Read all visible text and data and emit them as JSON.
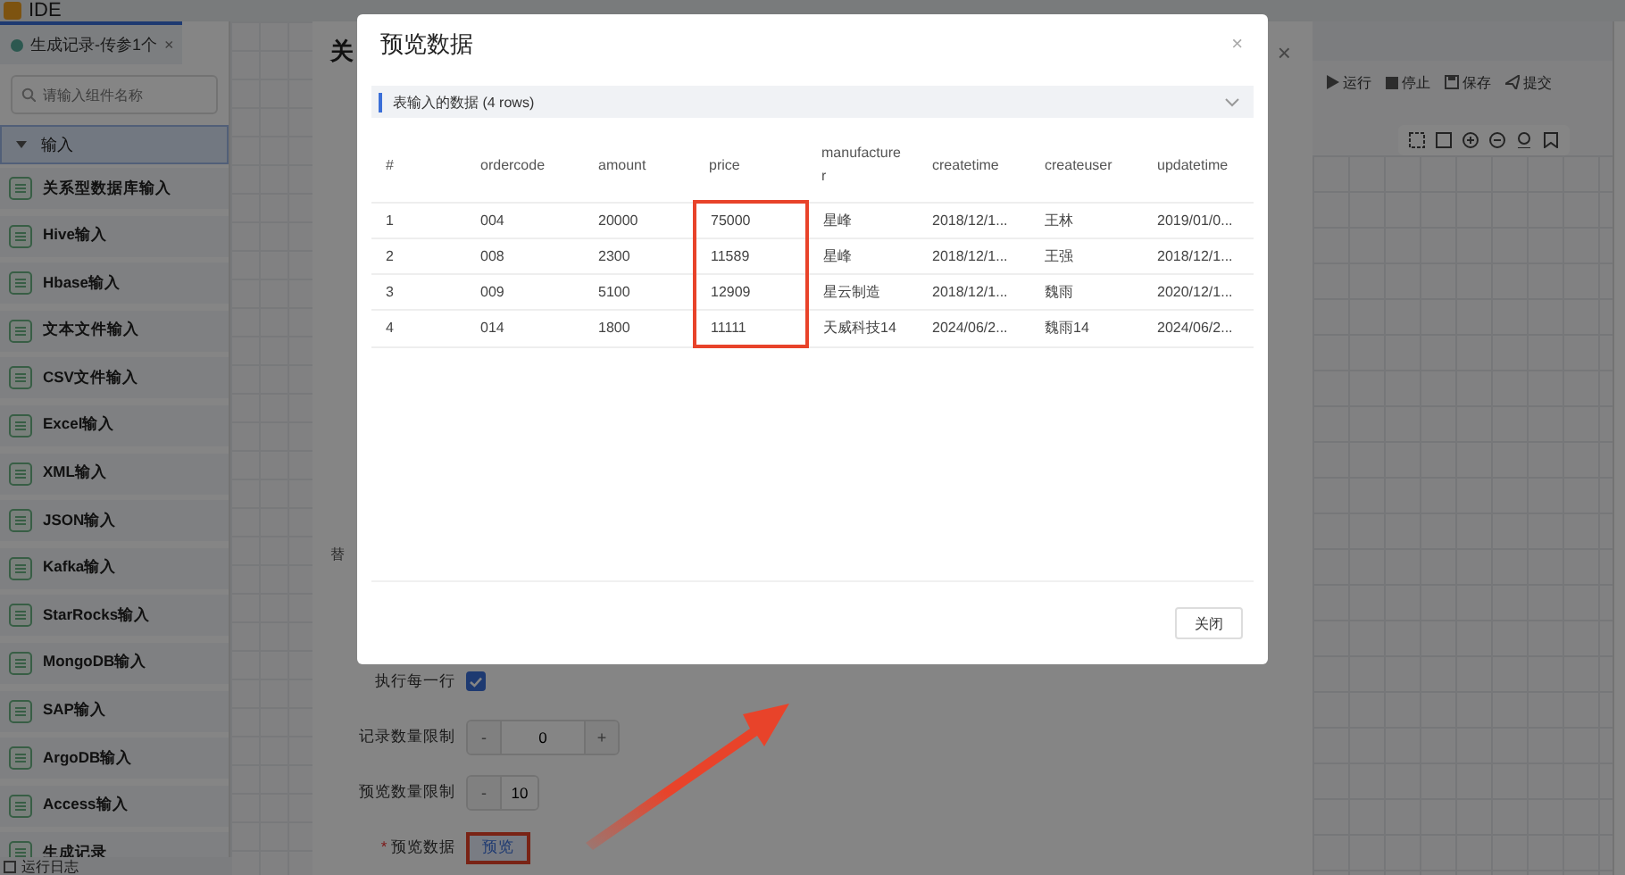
{
  "app": {
    "title": "IDE"
  },
  "tab": {
    "label": "生成记录-传参1个",
    "close": "×"
  },
  "search": {
    "placeholder": "请输入组件名称"
  },
  "category": {
    "label": "输入",
    "expanded": true
  },
  "components": [
    {
      "label": "关系型数据库输入"
    },
    {
      "label": "Hive输入"
    },
    {
      "label": "Hbase输入"
    },
    {
      "label": "文本文件输入"
    },
    {
      "label": "CSV文件输入"
    },
    {
      "label": "Excel输入"
    },
    {
      "label": "XML输入"
    },
    {
      "label": "JSON输入"
    },
    {
      "label": "Kafka输入"
    },
    {
      "label": "StarRocks输入"
    },
    {
      "label": "MongoDB输入"
    },
    {
      "label": "SAP输入"
    },
    {
      "label": "ArgoDB输入"
    },
    {
      "label": "Access输入"
    },
    {
      "label": "生成记录"
    }
  ],
  "log_bar": {
    "label": "运行日志"
  },
  "config_dialog": {
    "title": "关",
    "close": "×",
    "replace_label": "替",
    "execute_each_row": {
      "label": "执行每一行",
      "checked": true
    },
    "record_limit": {
      "label": "记录数量限制",
      "minus": "-",
      "value": "0",
      "plus": "+"
    },
    "preview_limit": {
      "label": "预览数量限制",
      "minus": "-",
      "value": "10"
    },
    "preview": {
      "label": "预览数据",
      "required_mark": "*",
      "button": "预览"
    }
  },
  "toolbar": [
    {
      "kind": "run",
      "label": "运行"
    },
    {
      "kind": "stop",
      "label": "停止"
    },
    {
      "kind": "save",
      "label": "保存"
    },
    {
      "kind": "submit",
      "label": "提交"
    }
  ],
  "preview_modal": {
    "title": "预览数据",
    "close": "×",
    "section": {
      "title": "表输入的数据 (4 rows)",
      "expanded": true
    },
    "table": {
      "columns": [
        {
          "label": "#",
          "highlighted": false
        },
        {
          "label": "ordercode",
          "highlighted": false
        },
        {
          "label": "amount",
          "highlighted": false
        },
        {
          "label": "price",
          "highlighted": true
        },
        {
          "label": "manufacturer",
          "highlighted": false
        },
        {
          "label": "createtime",
          "highlighted": false
        },
        {
          "label": "createuser",
          "highlighted": false
        },
        {
          "label": "updatetime",
          "highlighted": false
        }
      ],
      "rows": [
        [
          "1",
          "004",
          "20000",
          "75000",
          "星峰",
          "2018/12/1...",
          "王林",
          "2019/01/0..."
        ],
        [
          "2",
          "008",
          "2300",
          "11589",
          "星峰",
          "2018/12/1...",
          "王强",
          "2018/12/1..."
        ],
        [
          "3",
          "009",
          "5100",
          "12909",
          "星云制造",
          "2018/12/1...",
          "魏雨",
          "2020/12/1..."
        ],
        [
          "4",
          "014",
          "1800",
          "11111",
          "天威科技14",
          "2024/06/2...",
          "魏雨14",
          "2024/06/2..."
        ]
      ]
    },
    "close_button": "关闭"
  }
}
